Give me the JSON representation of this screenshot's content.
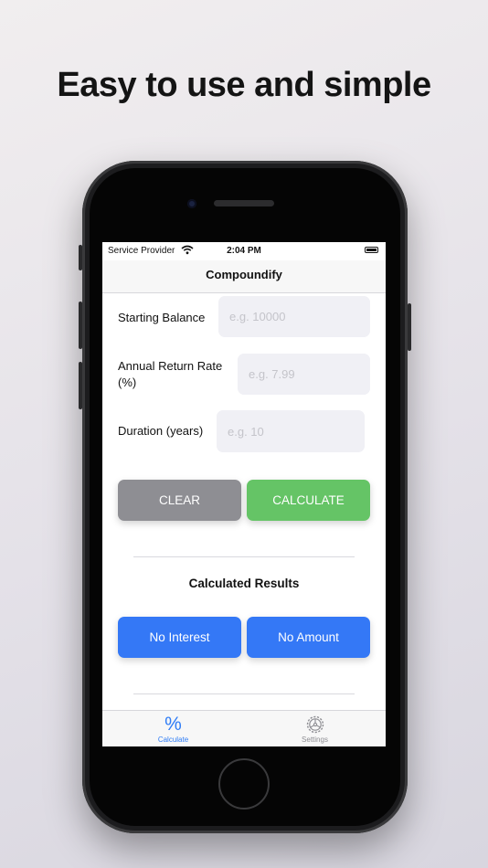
{
  "headline": "Easy to use and simple",
  "status_bar": {
    "carrier": "Service Provider",
    "time": "2:04 PM"
  },
  "nav": {
    "title": "Compoundify"
  },
  "form": {
    "starting_balance": {
      "label": "Starting Balance",
      "placeholder": "e.g. 10000",
      "value": ""
    },
    "annual_return": {
      "label_line1": "Annual Return Rate",
      "label_line2": "(%)",
      "placeholder": "e.g. 7.99",
      "value": ""
    },
    "duration": {
      "label": "Duration (years)",
      "placeholder": "e.g. 10",
      "value": ""
    }
  },
  "actions": {
    "clear_label": "CLEAR",
    "calculate_label": "CALCULATE"
  },
  "results": {
    "title": "Calculated Results",
    "interest_label": "No Interest",
    "amount_label": "No Amount"
  },
  "tabs": [
    {
      "icon": "percent-icon",
      "label": "Calculate",
      "active": true
    },
    {
      "icon": "gear-icon",
      "label": "Settings",
      "active": false
    }
  ],
  "colors": {
    "clear_button": "#8e8e93",
    "calculate_button": "#65c466",
    "result_button": "#3478f6",
    "tab_active": "#2f7cf6",
    "tab_inactive": "#8e8e93"
  }
}
